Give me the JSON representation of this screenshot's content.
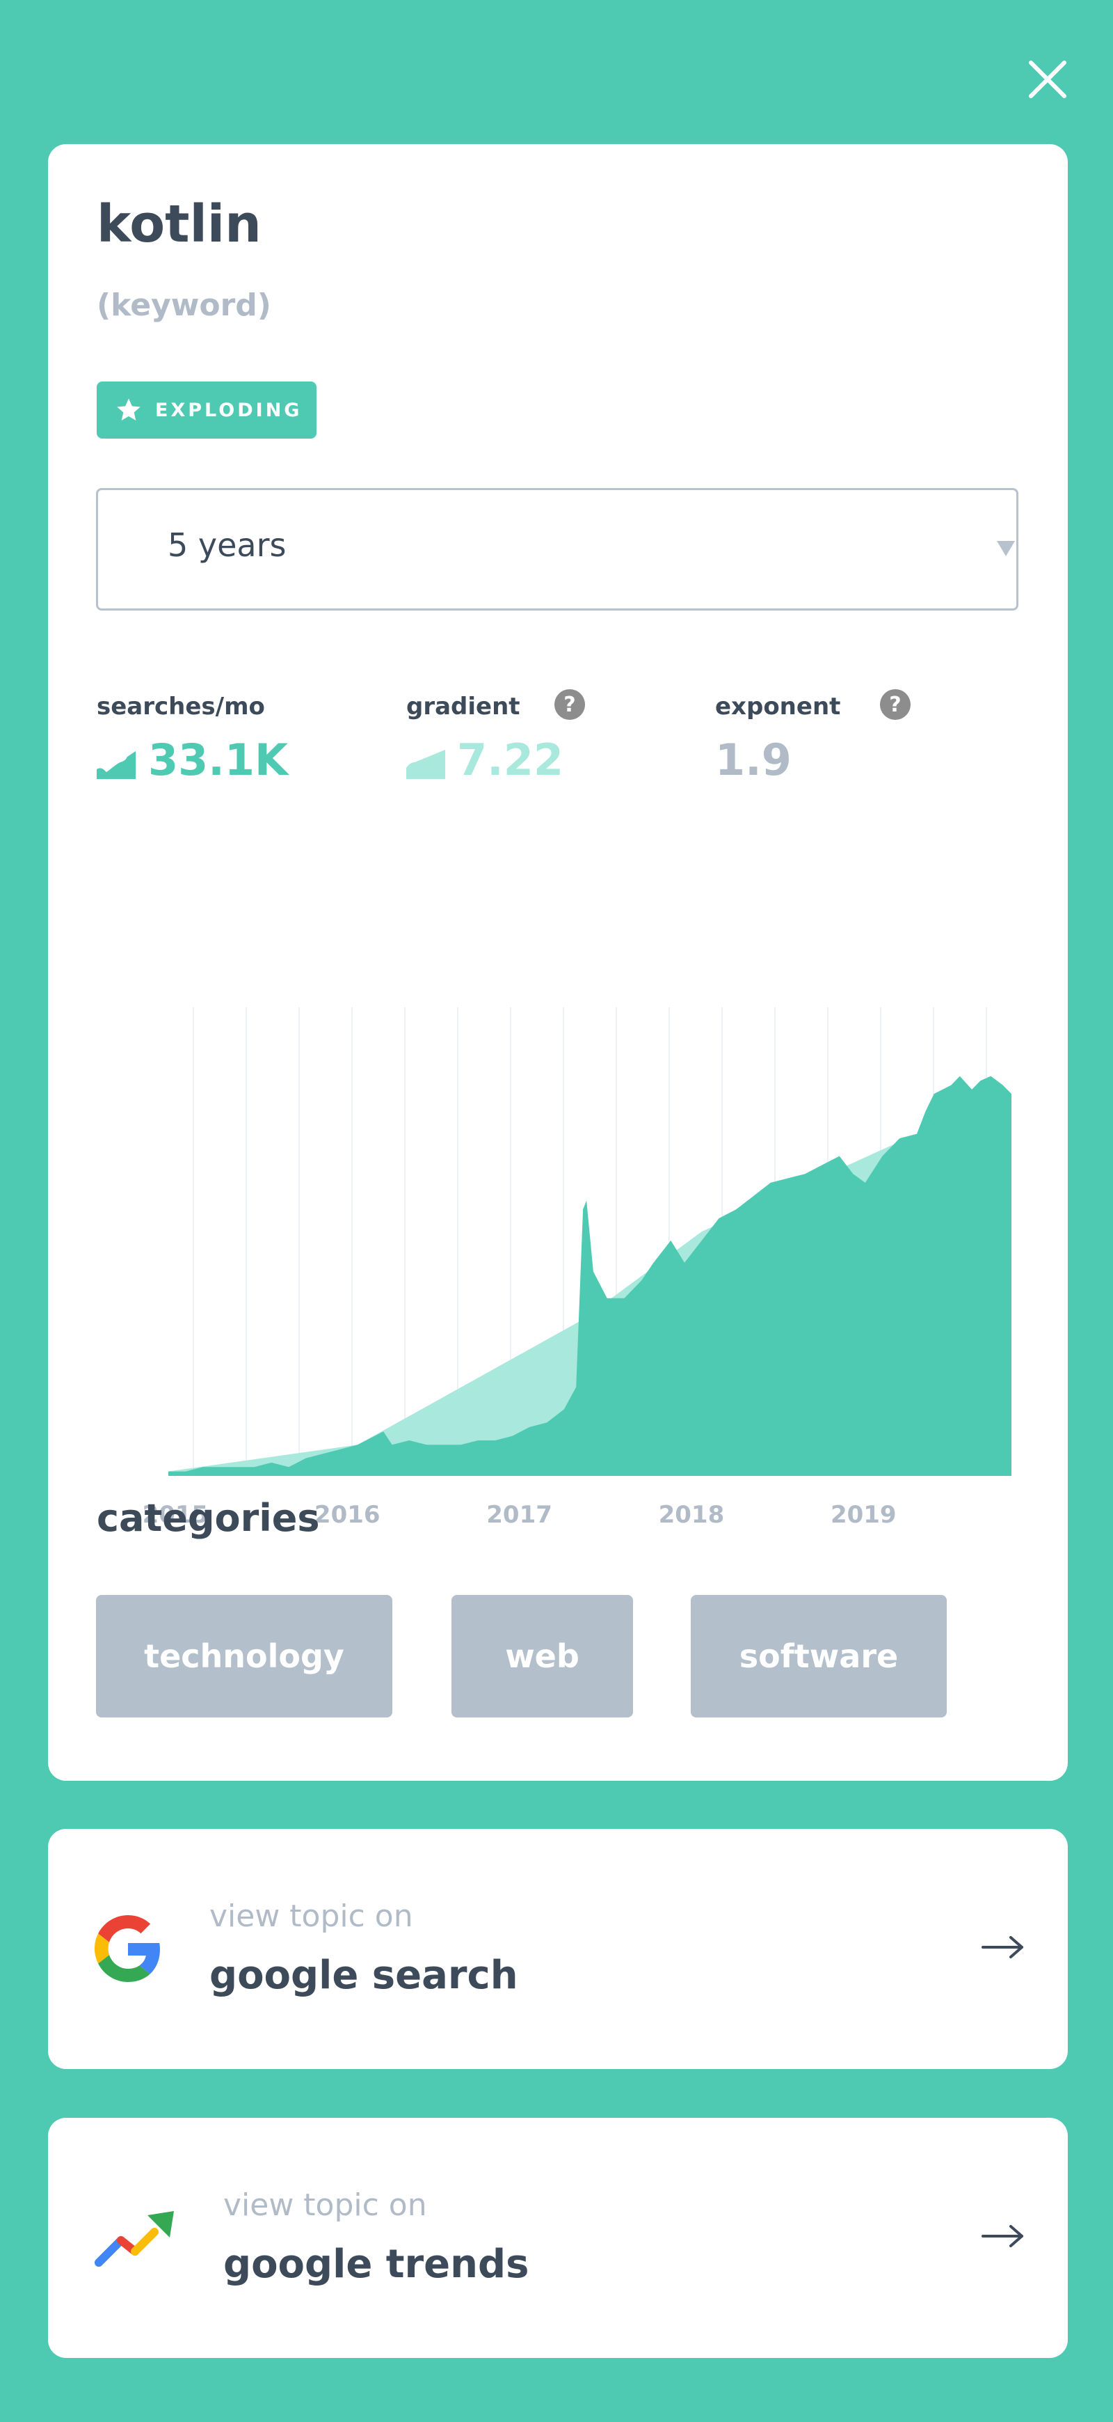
{
  "topic": {
    "title": "kotlin",
    "type_label": "(keyword)",
    "status_badge": "EXPLODING",
    "status_icon": "star-icon"
  },
  "timeframe_select": {
    "value": "5 years",
    "icon": "caret-down-icon"
  },
  "metrics": {
    "searches": {
      "label": "searches/mo",
      "value": "33.1K",
      "icon": "growth-chart-icon"
    },
    "gradient": {
      "label": "gradient",
      "value": "7.22",
      "icon": "gradient-wedge-icon",
      "help_icon": "question-icon"
    },
    "exponent": {
      "label": "exponent",
      "value": "1.9",
      "help_icon": "question-icon"
    }
  },
  "chart_data": {
    "type": "area",
    "x_tick_labels": [
      "2015",
      "2016",
      "2017",
      "2018",
      "2019"
    ],
    "ylim": [
      0,
      100
    ],
    "grid": "vertical",
    "series": [
      {
        "role": "search volume",
        "color": "#4ecab2",
        "points": [
          [
            2014.9,
            1
          ],
          [
            2015.0,
            1
          ],
          [
            2015.1,
            2
          ],
          [
            2015.2,
            2
          ],
          [
            2015.3,
            2
          ],
          [
            2015.4,
            2
          ],
          [
            2015.5,
            3
          ],
          [
            2015.6,
            2
          ],
          [
            2015.7,
            4
          ],
          [
            2015.8,
            5
          ],
          [
            2015.9,
            6
          ],
          [
            2016.0,
            7
          ],
          [
            2016.1,
            9
          ],
          [
            2016.15,
            10
          ],
          [
            2016.2,
            7
          ],
          [
            2016.3,
            8
          ],
          [
            2016.4,
            7
          ],
          [
            2016.5,
            7
          ],
          [
            2016.6,
            7
          ],
          [
            2016.7,
            8
          ],
          [
            2016.8,
            8
          ],
          [
            2016.9,
            9
          ],
          [
            2017.0,
            11
          ],
          [
            2017.1,
            12
          ],
          [
            2017.2,
            15
          ],
          [
            2017.27,
            20
          ],
          [
            2017.31,
            60
          ],
          [
            2017.33,
            62
          ],
          [
            2017.37,
            46
          ],
          [
            2017.45,
            40
          ],
          [
            2017.55,
            40
          ],
          [
            2017.65,
            44
          ],
          [
            2017.72,
            48
          ],
          [
            2017.82,
            53
          ],
          [
            2017.9,
            48
          ],
          [
            2018.0,
            53
          ],
          [
            2018.1,
            58
          ],
          [
            2018.2,
            60
          ],
          [
            2018.3,
            63
          ],
          [
            2018.4,
            66
          ],
          [
            2018.5,
            67
          ],
          [
            2018.6,
            68
          ],
          [
            2018.7,
            70
          ],
          [
            2018.8,
            72
          ],
          [
            2018.88,
            68
          ],
          [
            2018.95,
            66
          ],
          [
            2019.05,
            72
          ],
          [
            2019.15,
            76
          ],
          [
            2019.25,
            77
          ],
          [
            2019.3,
            82
          ],
          [
            2019.35,
            86
          ],
          [
            2019.45,
            88
          ],
          [
            2019.5,
            90
          ],
          [
            2019.57,
            87
          ],
          [
            2019.62,
            89
          ],
          [
            2019.68,
            90
          ],
          [
            2019.75,
            88
          ],
          [
            2019.8,
            86
          ]
        ]
      },
      {
        "role": "trend",
        "color": "#a9e8dc",
        "points": [
          [
            2014.9,
            1
          ],
          [
            2016.0,
            7
          ],
          [
            2017.3,
            35
          ],
          [
            2018.0,
            55
          ],
          [
            2019.25,
            77
          ],
          [
            2019.8,
            86
          ]
        ]
      }
    ]
  },
  "categories": {
    "heading": "categories",
    "items": [
      "technology",
      "web",
      "software"
    ]
  },
  "links": [
    {
      "pre": "view topic on",
      "label": "google search",
      "logo": "google-g-logo",
      "arrow": "arrow-right-icon"
    },
    {
      "pre": "view topic on",
      "label": "google trends",
      "logo": "google-trends-logo",
      "arrow": "arrow-right-icon"
    }
  ],
  "close_icon": "close-icon",
  "colors": {
    "background": "#4ecab2",
    "card": "#ffffff",
    "text_dark": "#3d4a59",
    "text_muted": "#b1bbc8",
    "accent": "#4ecab2",
    "chip": "#b3bfca"
  }
}
